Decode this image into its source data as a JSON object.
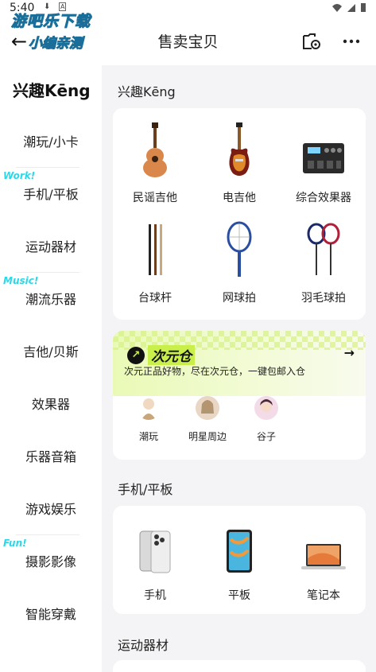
{
  "status_bar": {
    "time": "5:40"
  },
  "header": {
    "title": "售卖宝贝",
    "watermark_line1": "游吧乐下载",
    "watermark_line2": "小编亲测"
  },
  "sidebar": {
    "logo": "兴趣Kēng",
    "items": [
      {
        "label": "潮玩/小卡",
        "tag": ""
      },
      {
        "label": "手机/平板",
        "tag": "Work!"
      },
      {
        "label": "运动器材",
        "tag": ""
      },
      {
        "label": "潮流乐器",
        "tag": "Music!"
      },
      {
        "label": "吉他/贝斯",
        "tag": ""
      },
      {
        "label": "效果器",
        "tag": ""
      },
      {
        "label": "乐器音箱",
        "tag": ""
      },
      {
        "label": "游戏娱乐",
        "tag": ""
      },
      {
        "label": "摄影影像",
        "tag": "Fun!"
      },
      {
        "label": "智能穿戴",
        "tag": ""
      }
    ]
  },
  "sections": [
    {
      "title": "兴趣Kēng",
      "items": [
        {
          "label": "民谣吉他",
          "icon": "acoustic-guitar-icon"
        },
        {
          "label": "电吉他",
          "icon": "electric-guitar-icon"
        },
        {
          "label": "综合效果器",
          "icon": "effects-pedal-icon"
        },
        {
          "label": "台球杆",
          "icon": "billiard-cue-icon"
        },
        {
          "label": "网球拍",
          "icon": "tennis-racket-icon"
        },
        {
          "label": "羽毛球拍",
          "icon": "badminton-racket-icon"
        }
      ]
    },
    {
      "title": "手机/平板",
      "items": [
        {
          "label": "手机",
          "icon": "phone-icon"
        },
        {
          "label": "平板",
          "icon": "tablet-icon"
        },
        {
          "label": "笔记本",
          "icon": "laptop-icon"
        }
      ]
    },
    {
      "title": "运动器材"
    }
  ],
  "promo": {
    "brand": "次元仓",
    "description": "次元正品好物，尽在次元仓，一键包邮入仓",
    "items": [
      {
        "label": "潮玩"
      },
      {
        "label": "明星周边"
      },
      {
        "label": "谷子"
      }
    ]
  },
  "colors": {
    "accent": "#2bd8e8",
    "promo_green": "#c9f04a",
    "background": "#f4f4f6"
  }
}
